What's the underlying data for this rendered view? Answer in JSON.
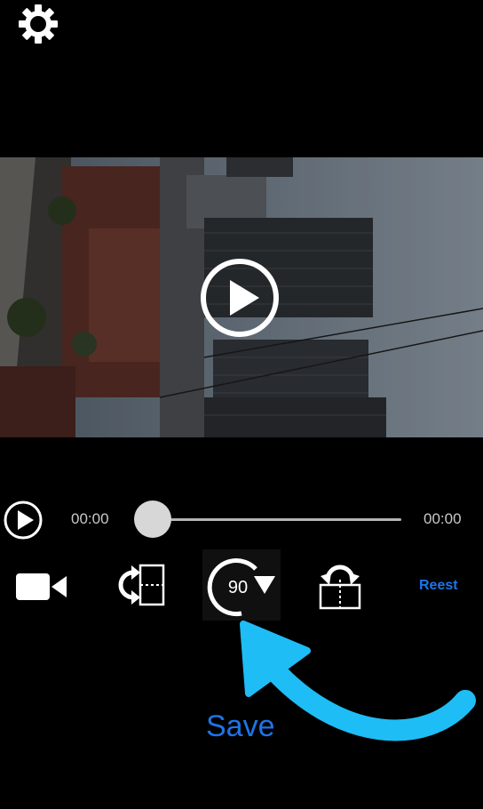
{
  "player": {
    "current_time": "00:00",
    "total_time": "00:00",
    "progress": 0
  },
  "toolbar": {
    "rotate_label": "90",
    "reset_label": "Reest"
  },
  "footer": {
    "save_label": "Save"
  },
  "colors": {
    "accent_blue": "#1e74e8",
    "arrow_cyan": "#1ebdf5",
    "background": "#000000"
  },
  "icons": {
    "settings": "gear-icon",
    "play_overlay": "play-circle-icon",
    "play_control": "play-circle-icon",
    "camera": "video-camera-icon",
    "flip": "flip-horizontal-icon",
    "rotate": "rotate-90-icon",
    "vflip": "flip-vertical-icon",
    "annotation": "curved-arrow-icon"
  }
}
